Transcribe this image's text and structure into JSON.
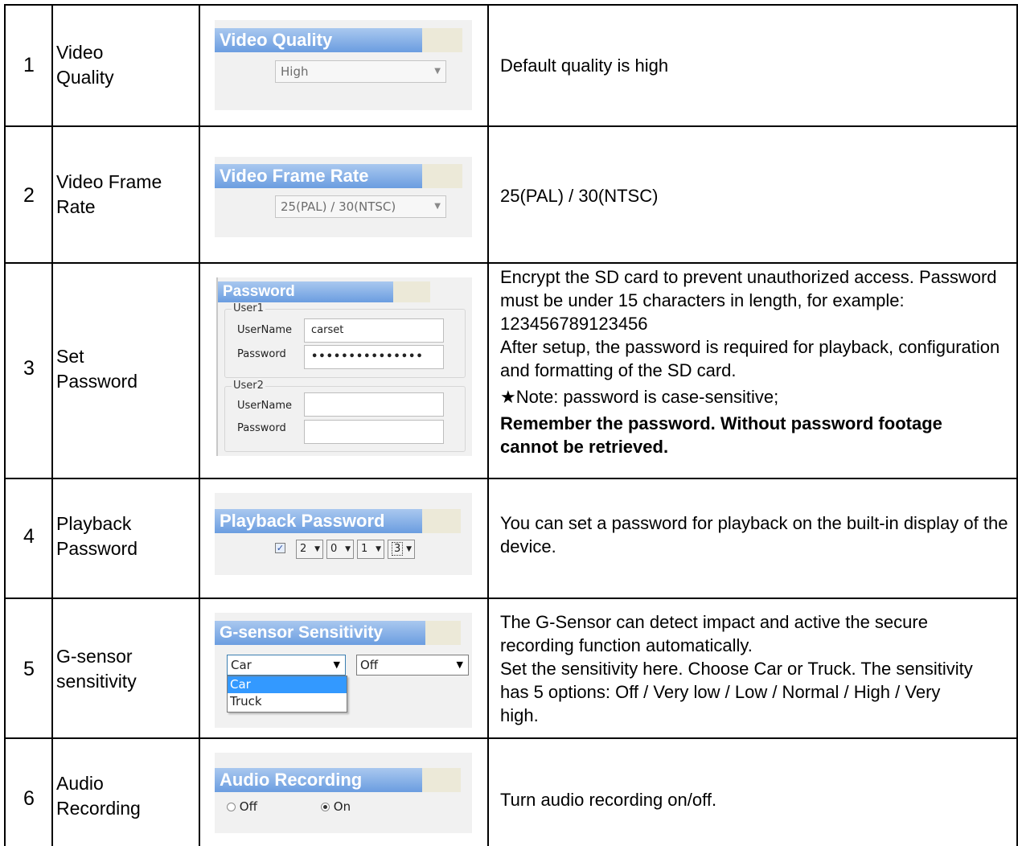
{
  "rows": [
    {
      "number": "1",
      "feature": "Video\nQuality",
      "panel": {
        "title": "Video Quality",
        "select_value": "High"
      },
      "description": [
        "Default quality is high"
      ]
    },
    {
      "number": "2",
      "feature": "Video Frame\nRate",
      "panel": {
        "title": "Video Frame Rate",
        "select_value": "25(PAL) / 30(NTSC)"
      },
      "description": [
        "25(PAL) / 30(NTSC)"
      ]
    },
    {
      "number": "3",
      "feature": "Set\nPassword",
      "panel": {
        "title": "Password",
        "user1_label": "User1",
        "user2_label": "User2",
        "username_label": "UserName",
        "password_label": "Password",
        "user1_username": "carset",
        "user1_password": "•••••••••••••••",
        "user2_username": "",
        "user2_password": ""
      },
      "description": [
        "Encrypt the SD card to prevent unauthorized access. Password must be under 15 characters in length, for example: 123456789123456",
        "After setup, the password is required for playback, configuration and formatting of the SD card.",
        "★Note: password is case-sensitive;"
      ],
      "description_bold": "Remember the password. Without password footage cannot be retrieved."
    },
    {
      "number": "4",
      "feature": "Playback\nPassword",
      "panel": {
        "title": "Playback Password",
        "enabled": true,
        "digits": [
          "2",
          "0",
          "1",
          "3"
        ]
      },
      "description": [
        "You can set a password for playback on the built-in display of the device."
      ]
    },
    {
      "number": "5",
      "feature": "G-sensor\nsensitivity",
      "panel": {
        "title": "G-sensor Sensitivity",
        "vehicle_value": "Car",
        "vehicle_options": [
          "Car",
          "Truck"
        ],
        "sensitivity_value": "Off"
      },
      "description": [
        "The G-Sensor can detect impact and active the secure recording function automatically.",
        "Set the sensitivity here. Choose Car or Truck. The sensitivity has 5 options: Off / Very low / Low / Normal / High / Very high."
      ]
    },
    {
      "number": "6",
      "feature": "Audio\nRecording",
      "panel": {
        "title": "Audio Recording",
        "option_off": "Off",
        "option_on": "On",
        "selected": "On"
      },
      "description": [
        "Turn audio recording on/off."
      ]
    }
  ],
  "colors": {
    "title_bar_top": "#a9c8ef",
    "title_bar_bottom": "#6b9de0",
    "highlight": "#3399ff"
  }
}
